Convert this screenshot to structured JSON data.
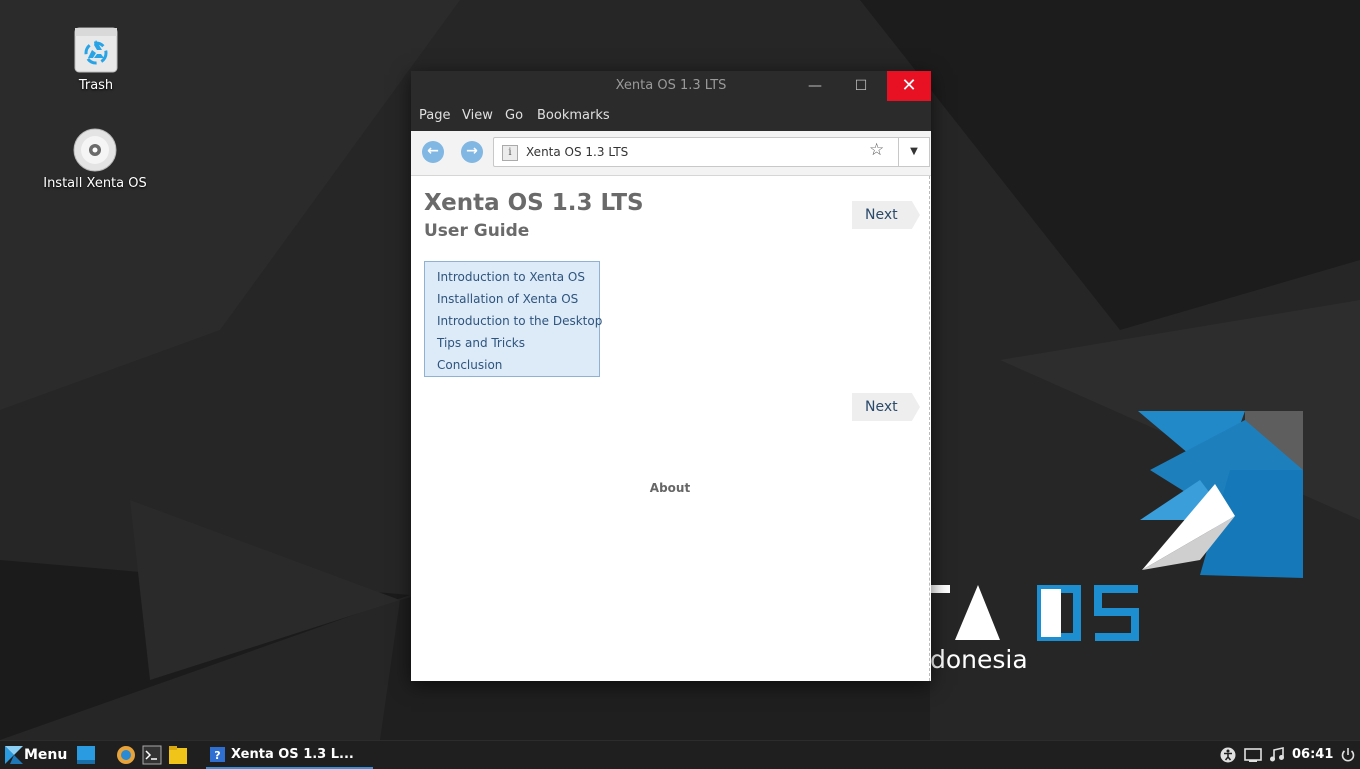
{
  "desktop": {
    "icons": [
      {
        "label": "Trash",
        "icon": "trash-icon"
      },
      {
        "label": "Install Xenta OS",
        "icon": "disc-icon"
      }
    ],
    "wallpaper": {
      "logo_text": "TA OS",
      "tagline": "donesia",
      "accent": "#1d8fd1"
    }
  },
  "window": {
    "title": "Xenta OS 1.3 LTS",
    "buttons": {
      "minimize": "—",
      "maximize": "☐",
      "close": "✕"
    },
    "menu": [
      "Page",
      "View",
      "Go",
      "Bookmarks"
    ],
    "toolbar": {
      "back_icon": "arrow-left-icon",
      "forward_icon": "arrow-right-icon",
      "url": "Xenta OS 1.3 LTS",
      "info_glyph": "i"
    }
  },
  "doc": {
    "title": "Xenta OS 1.3 LTS",
    "subtitle": "User Guide",
    "next_label": "Next",
    "toc": [
      "Introduction to Xenta OS",
      "Installation of Xenta OS",
      "Introduction to the Desktop",
      "Tips and Tricks",
      "Conclusion"
    ],
    "about": "About"
  },
  "taskbar": {
    "menu_label": "Menu",
    "task_label": "Xenta OS 1.3 L...",
    "clock": "06:41",
    "active_color": "#3d8fd8"
  }
}
